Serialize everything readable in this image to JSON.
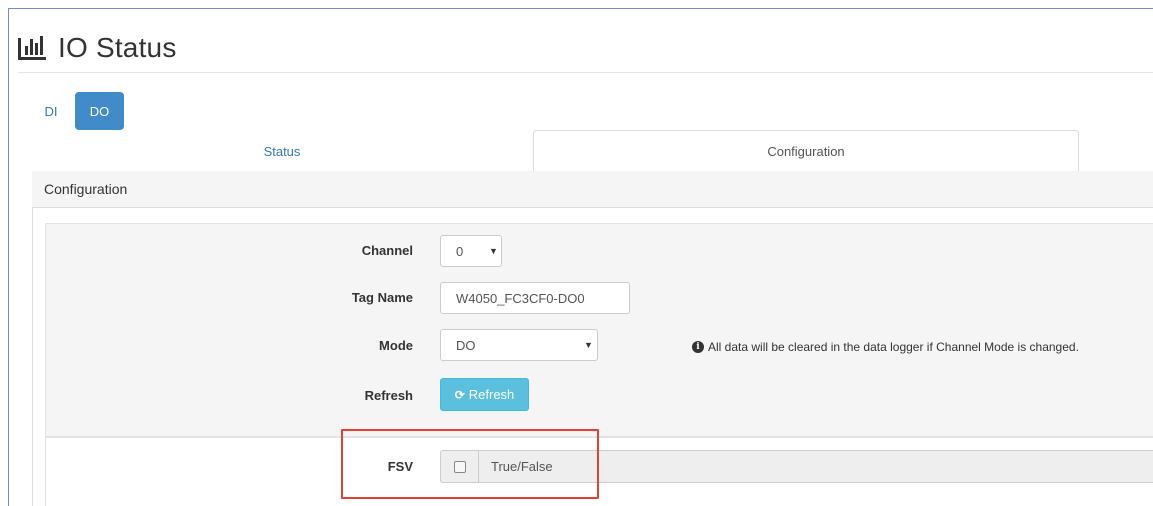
{
  "header": {
    "title": "IO Status",
    "icon": "bar-chart-icon"
  },
  "io_type_pills": [
    {
      "label": "DI",
      "active": false
    },
    {
      "label": "DO",
      "active": true
    }
  ],
  "tabs": [
    {
      "label": "Status",
      "active": false
    },
    {
      "label": "Configuration",
      "active": true
    }
  ],
  "panel": {
    "heading": "Configuration"
  },
  "form": {
    "channel": {
      "label": "Channel",
      "value": "0"
    },
    "tag_name": {
      "label": "Tag Name",
      "value": "W4050_FC3CF0-DO0"
    },
    "mode": {
      "label": "Mode",
      "value": "DO",
      "note": "All data will be cleared in the data logger if Channel Mode is changed."
    },
    "refresh": {
      "label": "Refresh",
      "button_label": "Refresh"
    },
    "fsv": {
      "label": "FSV",
      "checked": false,
      "text": "True/False"
    }
  },
  "colors": {
    "primary": "#428bca",
    "info": "#5bc0de",
    "highlight": "#e3403a",
    "link": "#337ab7"
  }
}
